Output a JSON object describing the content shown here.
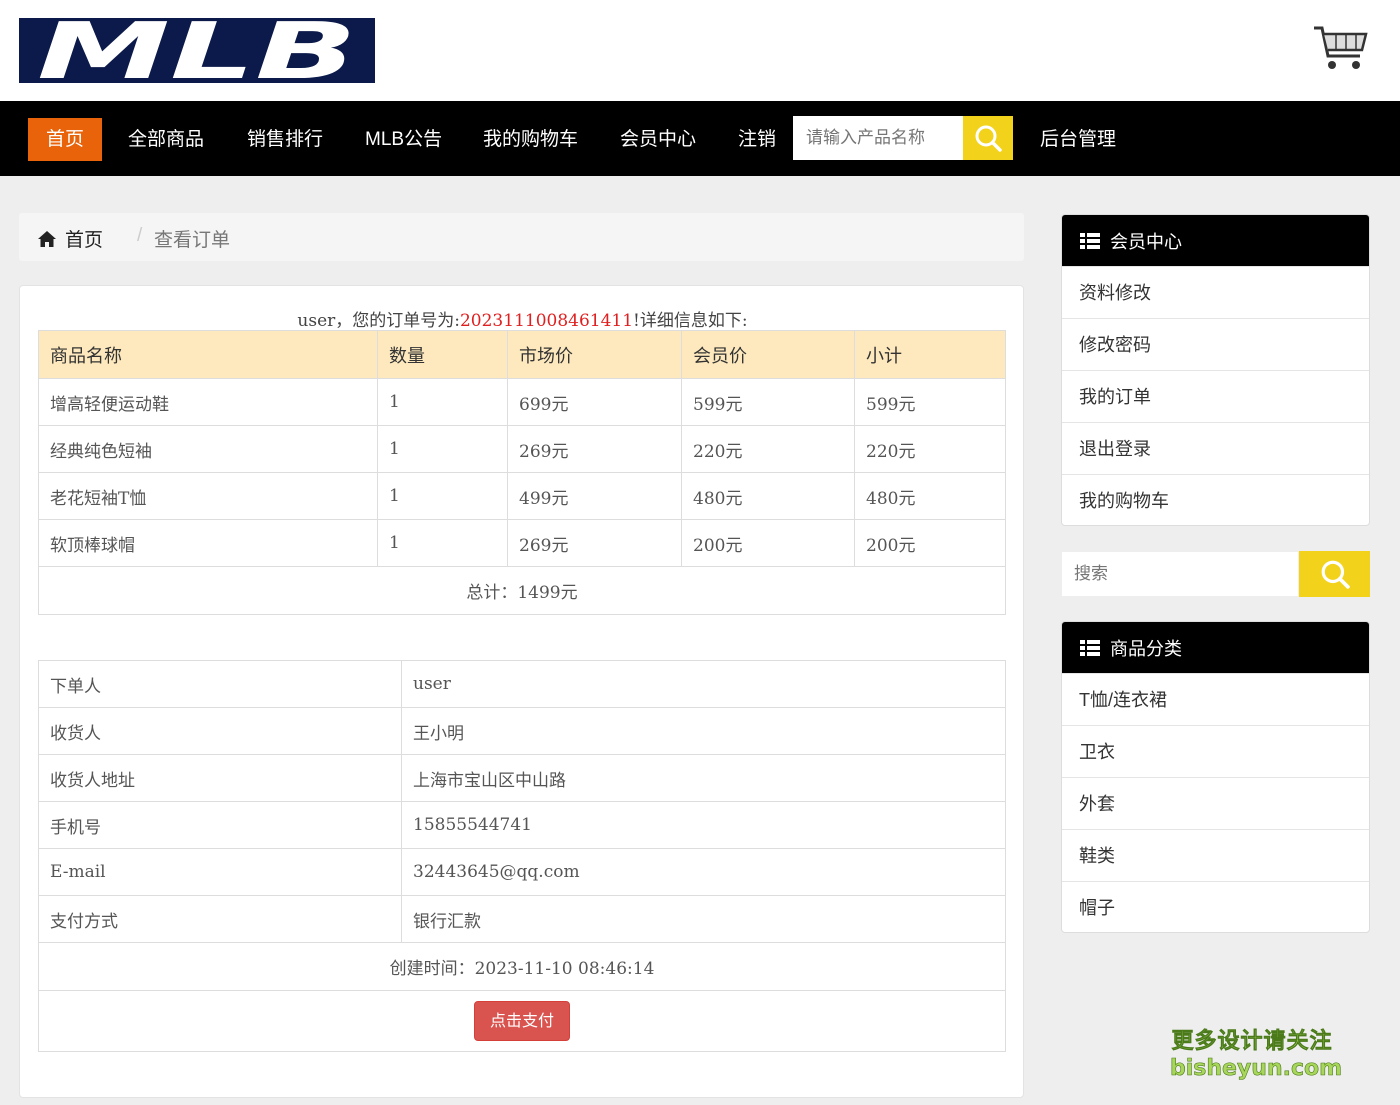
{
  "brand": {
    "logo_text": "MLB"
  },
  "nav": {
    "items": [
      "首页",
      "全部商品",
      "销售排行",
      "MLB公告",
      "我的购物车",
      "会员中心",
      "注销"
    ],
    "search_placeholder": "请输入产品名称",
    "admin": "后台管理"
  },
  "breadcrumb": {
    "home": "首页",
    "current": "查看订单"
  },
  "order": {
    "title_prefix": "user，您的订单号为:",
    "number": "2023111008461411",
    "title_suffix": "!详细信息如下:",
    "columns": [
      "商品名称",
      "数量",
      "市场价",
      "会员价",
      "小计"
    ],
    "rows": [
      [
        "增高轻便运动鞋",
        "1",
        "699元",
        "599元",
        "599元"
      ],
      [
        "经典纯色短袖",
        "1",
        "269元",
        "220元",
        "220元"
      ],
      [
        "老花短袖T恤",
        "1",
        "499元",
        "480元",
        "480元"
      ],
      [
        "软顶棒球帽",
        "1",
        "269元",
        "200元",
        "200元"
      ]
    ],
    "total": "总计：1499元"
  },
  "info": {
    "rows": [
      [
        "下单人",
        "user"
      ],
      [
        "收货人",
        "王小明"
      ],
      [
        "收货人地址",
        "上海市宝山区中山路"
      ],
      [
        "手机号",
        "15855544741"
      ],
      [
        "E-mail",
        "32443645@qq.com"
      ],
      [
        "支付方式",
        "银行汇款"
      ]
    ],
    "created": "创建时间：2023-11-10 08:46:14",
    "pay_button": "点击支付"
  },
  "sidebar": {
    "member_title": "会员中心",
    "member_items": [
      "资料修改",
      "修改密码",
      "我的订单",
      "退出登录",
      "我的购物车"
    ],
    "search_placeholder": "搜索",
    "category_title": "商品分类",
    "category_items": [
      "T恤/连衣裙",
      "卫衣",
      "外套",
      "鞋类",
      "帽子"
    ]
  },
  "watermark": {
    "line1": "更多设计请关注",
    "line2": "bisheyun.com"
  },
  "colors": {
    "accent": "#e8630a",
    "search": "#f2d21a",
    "highlight": "#e02020",
    "pay": "#d9534f",
    "table_head": "#fde9bd"
  }
}
